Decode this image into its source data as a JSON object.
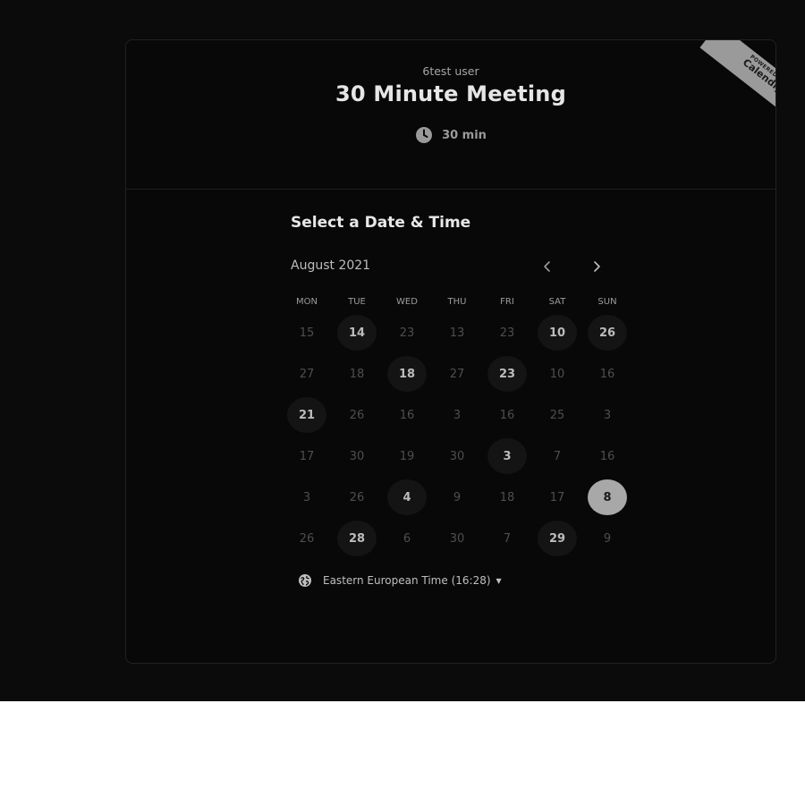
{
  "event": {
    "organizer": "6test user",
    "title": "30 Minute Meeting",
    "duration": "30 min"
  },
  "badge": {
    "line1": "POWERED BY",
    "line2": "Calendly"
  },
  "picker": {
    "title": "Select a Date & Time",
    "month": "August 2021",
    "weekdays": [
      "MON",
      "TUE",
      "WED",
      "THU",
      "FRI",
      "SAT",
      "SUN"
    ],
    "days": [
      {
        "label": "15",
        "state": "disabled"
      },
      {
        "label": "14",
        "state": "available"
      },
      {
        "label": "23",
        "state": "disabled"
      },
      {
        "label": "13",
        "state": "disabled"
      },
      {
        "label": "23",
        "state": "disabled"
      },
      {
        "label": "10",
        "state": "available"
      },
      {
        "label": "26",
        "state": "available"
      },
      {
        "label": "27",
        "state": "disabled"
      },
      {
        "label": "18",
        "state": "disabled"
      },
      {
        "label": "18",
        "state": "available"
      },
      {
        "label": "27",
        "state": "disabled"
      },
      {
        "label": "23",
        "state": "available"
      },
      {
        "label": "10",
        "state": "disabled"
      },
      {
        "label": "16",
        "state": "disabled"
      },
      {
        "label": "21",
        "state": "available"
      },
      {
        "label": "26",
        "state": "disabled"
      },
      {
        "label": "16",
        "state": "disabled"
      },
      {
        "label": "3",
        "state": "disabled"
      },
      {
        "label": "16",
        "state": "disabled"
      },
      {
        "label": "25",
        "state": "disabled"
      },
      {
        "label": "3",
        "state": "disabled"
      },
      {
        "label": "17",
        "state": "disabled"
      },
      {
        "label": "30",
        "state": "disabled"
      },
      {
        "label": "19",
        "state": "disabled"
      },
      {
        "label": "30",
        "state": "disabled"
      },
      {
        "label": "3",
        "state": "available"
      },
      {
        "label": "7",
        "state": "disabled"
      },
      {
        "label": "16",
        "state": "disabled"
      },
      {
        "label": "3",
        "state": "disabled"
      },
      {
        "label": "26",
        "state": "disabled"
      },
      {
        "label": "4",
        "state": "available"
      },
      {
        "label": "9",
        "state": "disabled"
      },
      {
        "label": "18",
        "state": "disabled"
      },
      {
        "label": "17",
        "state": "disabled"
      },
      {
        "label": "8",
        "state": "selected"
      },
      {
        "label": "26",
        "state": "disabled"
      },
      {
        "label": "28",
        "state": "available"
      },
      {
        "label": "6",
        "state": "disabled"
      },
      {
        "label": "30",
        "state": "disabled"
      },
      {
        "label": "7",
        "state": "disabled"
      },
      {
        "label": "29",
        "state": "available"
      },
      {
        "label": "9",
        "state": "disabled"
      }
    ]
  },
  "timezone": {
    "label": "Eastern European Time (16:28)"
  },
  "icons": {
    "duration": "clock-icon",
    "timezone": "globe-icon",
    "prev": "chevron-left-icon",
    "next": "chevron-right-icon",
    "dropdown": "caret-down-icon"
  }
}
